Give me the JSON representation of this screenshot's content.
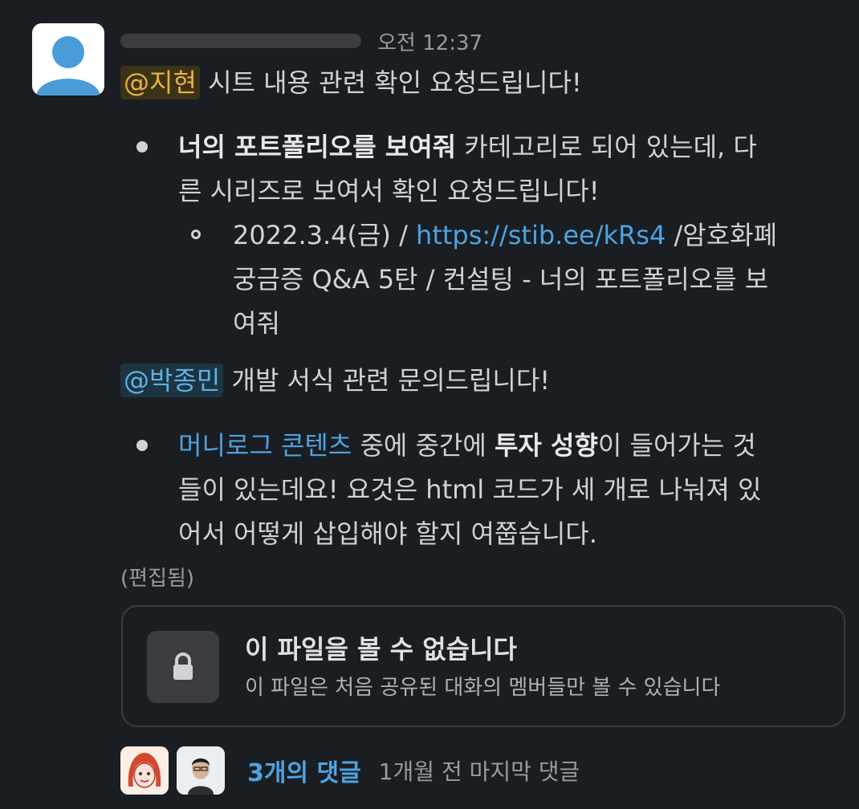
{
  "message": {
    "timestamp": "오전 12:37",
    "edited": "(편집됨)",
    "para1": {
      "mention": "@지현",
      "text": " 시트 내용 관련 확인 요청드립니다!"
    },
    "bullet1": {
      "bold": "너의 포트폴리오를 보여줘",
      "text_a": " 카테고리로 되어 있는데, 다",
      "text_b": "른 시리즈로 보여서 확인 요청드립니다!",
      "sub": {
        "prefix": "2022.3.4(금) / ",
        "link": "https://stib.ee/kRs4",
        "suffix": " /암호화폐",
        "line2": "궁금증 Q&A 5탄 / 컨설팅 - 너의 포트폴리오를 보",
        "line3": "여줘"
      }
    },
    "para2": {
      "mention": "@박종민",
      "text": " 개발 서식 관련 문의드립니다!"
    },
    "bullet2": {
      "link": "머니로그 콘텐츠",
      "text_a": " 중에 중간에 ",
      "bold": "투자 성향",
      "text_b": "이 들어가는 것",
      "line2": "들이 있는데요! 요것은 html 코드가 세 개로 나눠져 있",
      "line3": "어서 어떻게 삽입해야 할지 여쭙습니다."
    }
  },
  "file_card": {
    "title": "이 파일을 볼 수 없습니다",
    "subtitle": "이 파일은 처음 공유된 대화의 멤버들만 볼 수 있습니다",
    "icon": "lock-icon"
  },
  "thread": {
    "reply_count": "3개의 댓글",
    "last_reply": "1개월 전 마지막 댓글"
  },
  "colors": {
    "background": "#1a1d21",
    "link": "#4da3e0",
    "mention_yellow": "#e8b23e",
    "mention_blue": "#5fb1e3"
  }
}
